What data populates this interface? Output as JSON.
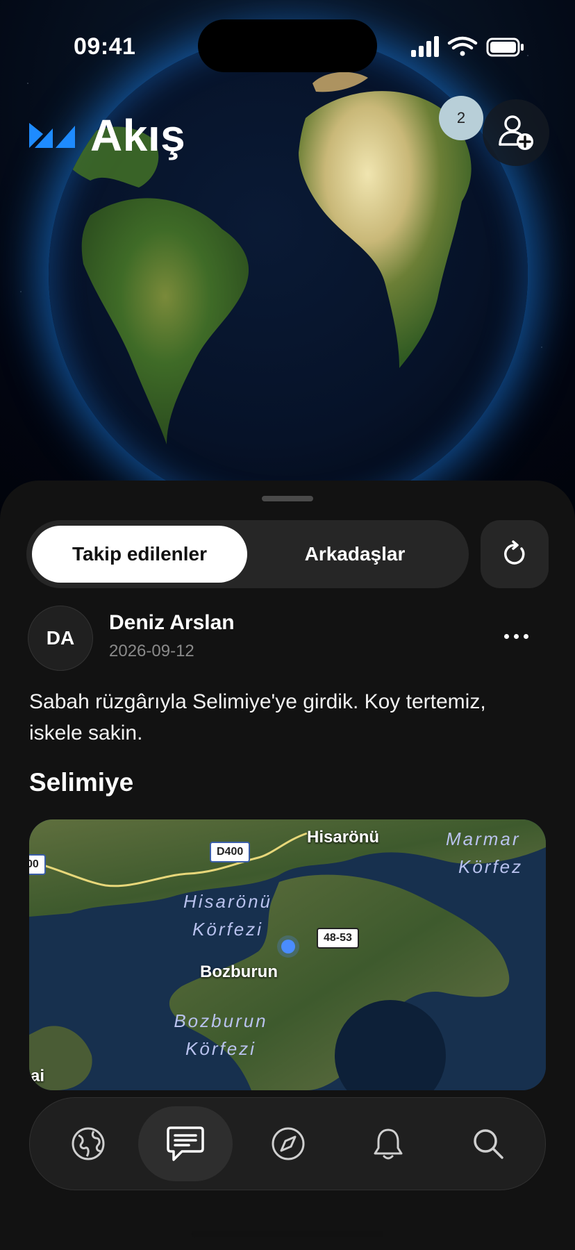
{
  "status_bar": {
    "time": "09:41"
  },
  "header": {
    "title": "Akış",
    "notification_count": "2"
  },
  "segments": {
    "following": "Takip edilenler",
    "friends": "Arkadaşlar"
  },
  "post": {
    "avatar_initials": "DA",
    "author": "Deniz Arslan",
    "date": "2026-09-12",
    "text": "Sabah rüzgârıyla Selimiye'ye girdik. Koy tertemiz, iskele sakin.",
    "place": "Selimiye",
    "map": {
      "labels": {
        "hisaronu": "Hisarönü",
        "bozburun": "Bozburun",
        "hisaronu_korfezi_1": "Hisarönü",
        "hisaronu_korfezi_2": "Körfezi",
        "bozburun_korfezi_1": "Bozburun",
        "bozburun_korfezi_2": "Körfezi",
        "marmaris_1": "Marmar",
        "marmaris_2": "Körfez",
        "road_d400": "D400",
        "road_4853": "48-53",
        "road_left": "00",
        "edge_left": "ai"
      }
    }
  },
  "tabbar": {
    "items": [
      {
        "icon": "globe-icon"
      },
      {
        "icon": "message-icon",
        "active": true
      },
      {
        "icon": "compass-icon"
      },
      {
        "icon": "bell-icon"
      },
      {
        "icon": "search-icon"
      }
    ]
  },
  "colors": {
    "accent": "#1e8bff",
    "sheet_bg": "#121212",
    "segment_bg": "#262626"
  }
}
